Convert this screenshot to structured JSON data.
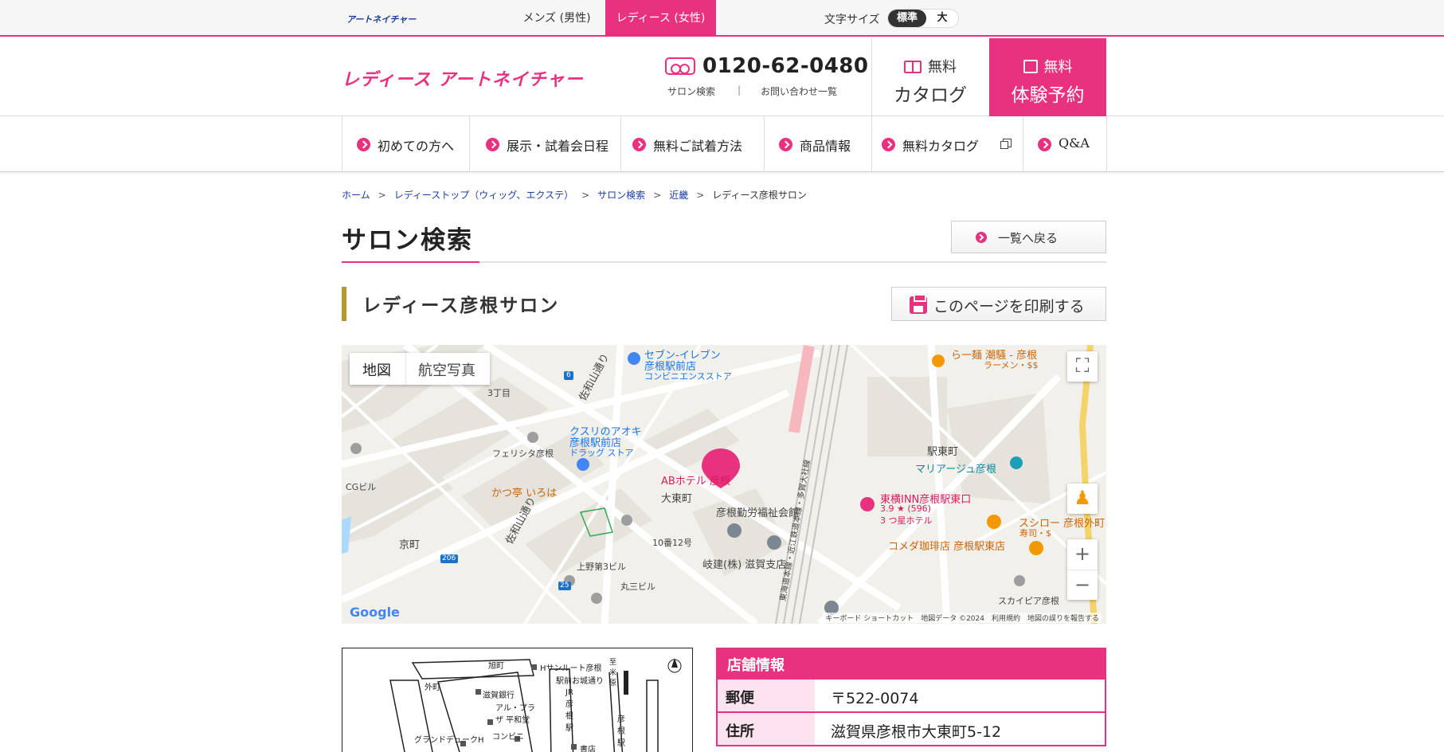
{
  "topbar": {
    "logo": "アートネイチャー",
    "tab_men": "メンズ (男性)",
    "tab_ladies": "レディース (女性)",
    "font_size_label": "文字サイズ",
    "size_standard": "標準",
    "size_large": "大"
  },
  "header": {
    "brand": "レディース アートネイチャー",
    "phone": "0120-62-0480",
    "link_salon": "サロン検索",
    "link_sep": "|",
    "link_inquiry": "お問い合わせ一覧",
    "catalog_top": "無料",
    "catalog_bottom": "カタログ",
    "trial_top": "無料",
    "trial_bottom": "体験予約"
  },
  "nav": {
    "items": [
      {
        "label": "初めての方へ"
      },
      {
        "label": "展示・試着会日程"
      },
      {
        "label": "無料ご試着方法"
      },
      {
        "label": "商品情報"
      },
      {
        "label": "無料カタログ"
      },
      {
        "label": "Q&A"
      }
    ]
  },
  "breadcrumb": {
    "items": [
      "ホーム",
      "レディーストップ（ウィッグ、エクステ）",
      "サロン検索",
      "近畿",
      "レディース彦根サロン"
    ],
    "separator": ">"
  },
  "page": {
    "title": "サロン検索",
    "back_button": "一覧へ戻る",
    "salon_name": "レディース彦根サロン",
    "print_button": "このページを印刷する"
  },
  "map": {
    "type_map": "地図",
    "type_satellite": "航空写真",
    "zoom_in": "+",
    "zoom_out": "−",
    "fullscreen": "⛶",
    "google": "Google",
    "footer": "キーボード ショートカット　地図データ ©2024　利用規約　地図の誤りを報告する",
    "labels": {
      "seven": "セブン-イレブン",
      "seven2": "彦根駅前店",
      "seven3": "コンビニエンスストア",
      "street1": "佐和山通り",
      "street2": "佐和山通り",
      "chome": "3丁目",
      "kusuri": "クスリのアオキ",
      "kusuri2": "彦根駅前店",
      "kusuri3": "ドラッグ ストア",
      "felicita": "フェリシタ彦根",
      "cg": "CGビル",
      "katsu": "かつ亭 いろは",
      "abhotel": "ABホテル 彦根",
      "daito": "大東町",
      "kinro": "彦根勤労福祉会館",
      "no10": "10番12号",
      "gifu": "岐建(株) 滋賀支店",
      "kyomachi": "京町",
      "uwano": "上野第3ビル",
      "marusan": "丸三ビル",
      "ramen": "ら一麺 潮騒 - 彦根",
      "ramen2": "ラーメン・$$",
      "ekihigashi": "駅東町",
      "mariage": "マリアージュ彦根",
      "toyoko": "東横INN彦根駅東口",
      "toyoko2": "3.9 ★ (596)",
      "toyoko3": "3 つ星ホテル",
      "sushiro": "スシロー 彦根外町",
      "sushiro2": "寿司・$",
      "komeda": "コメダ珈琲店 彦根駅東店",
      "skypia": "スカイピア彦根",
      "rail": "東海道本線・近江鉄道本線・多賀大社線",
      "r6": "6",
      "r206": "206",
      "r25": "25"
    }
  },
  "access_map": {
    "labels": [
      "旭町",
      "Hサンルート彦根",
      "駅前お城通り",
      "外町",
      "滋賀銀行",
      "JR 彦根駅",
      "アル・プラザ 平和堂",
      "グランドデュークH",
      "コンビニ",
      "書店",
      "彦根駅",
      "至 米原"
    ]
  },
  "store_info": {
    "heading": "店舗情報",
    "rows": [
      {
        "label": "郵便",
        "value": "〒522-0074"
      },
      {
        "label": "住所",
        "value": "滋賀県彦根市大東町5-12"
      }
    ]
  },
  "colors": {
    "accent": "#e8327f",
    "gold": "#b8962a",
    "link": "#1a3ca8"
  }
}
